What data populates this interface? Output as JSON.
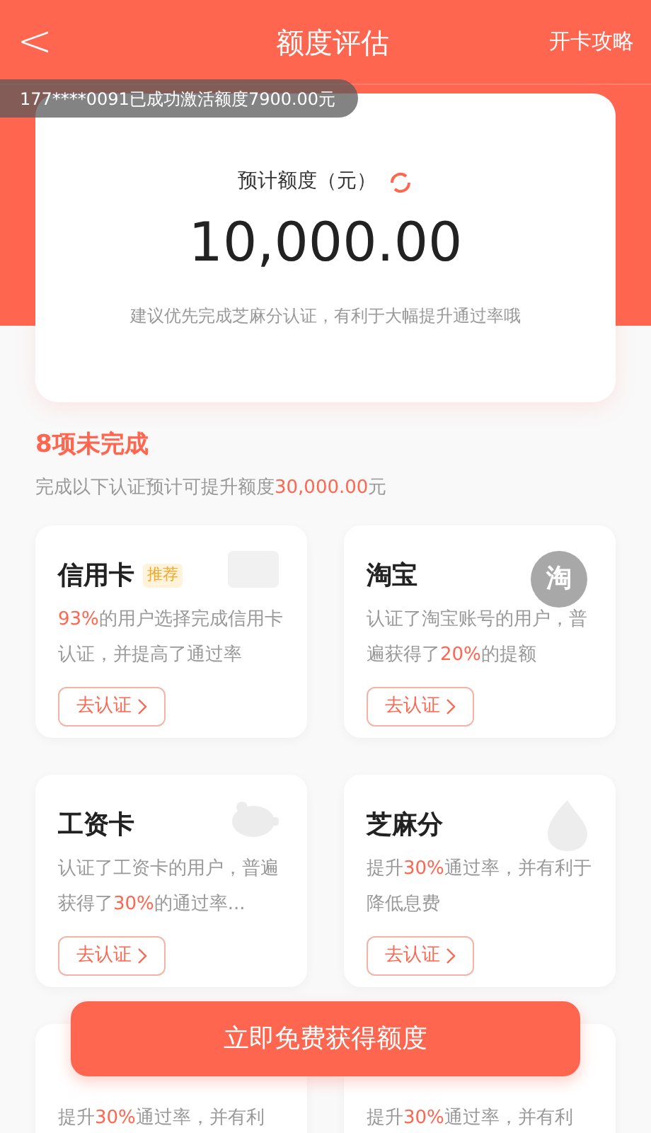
{
  "header": {
    "back": "<",
    "title": "额度评估",
    "action": "开卡攻略"
  },
  "toast": "177****0091已成功激活额度7900.00元",
  "estimate": {
    "label": "预计额度（元）",
    "amount": "10,000.00",
    "tip": "建议优先完成芝麻分认证，有利于大幅提升通过率哦"
  },
  "section": {
    "title": "8项未完成",
    "subtitle": [
      {
        "text": "完成以下认证预计可提升额度"
      },
      {
        "text": "30,000.00",
        "highlight": true
      },
      {
        "text": "元"
      }
    ]
  },
  "cards": [
    {
      "title": "信用卡",
      "badge": "推荐",
      "desc": [
        {
          "text": "93%",
          "highlight": true
        },
        {
          "text": "的用户选择完成信用卡认证，并提高了通过率"
        }
      ],
      "button": "去认证"
    },
    {
      "title": "淘宝",
      "logo_text": "淘",
      "desc": [
        {
          "text": "认证了淘宝账号的用户，普遍获得了"
        },
        {
          "text": "20%",
          "highlight": true
        },
        {
          "text": "的提额"
        }
      ],
      "button": "去认证"
    },
    {
      "title": "工资卡",
      "desc": [
        {
          "text": "认证了工资卡的用户，普遍获得了"
        },
        {
          "text": "30%",
          "highlight": true
        },
        {
          "text": "的通过率..."
        }
      ],
      "button": "去认证"
    },
    {
      "title": "芝麻分",
      "desc": [
        {
          "text": "提升"
        },
        {
          "text": "30%",
          "highlight": true
        },
        {
          "text": "通过率，并有利于降低息费"
        }
      ],
      "button": "去认证"
    },
    {
      "desc": [
        {
          "text": "提升"
        },
        {
          "text": "30%",
          "highlight": true
        },
        {
          "text": "通过率，并有利"
        }
      ]
    },
    {
      "desc": [
        {
          "text": "提升"
        },
        {
          "text": "30%",
          "highlight": true
        },
        {
          "text": "通过率，并有利"
        }
      ]
    }
  ],
  "cta": "立即免费获得额度"
}
